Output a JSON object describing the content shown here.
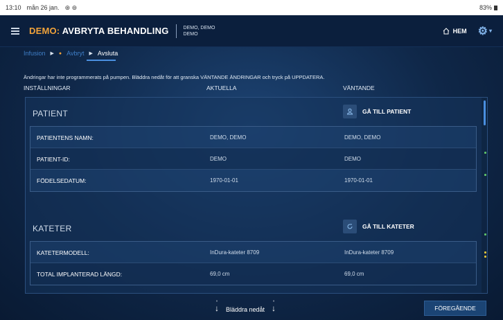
{
  "status_bar": {
    "time": "13:10",
    "date": "mån 26 jan.",
    "icons": "⊛ ⊚",
    "battery": "83%"
  },
  "app_bar": {
    "title_prefix": "DEMO:",
    "title_main": "AVBRYTA BEHANDLING",
    "patient_line1": "DEMO, DEMO",
    "patient_line2": "DEMO",
    "home_label": "HEM",
    "menu_icon": "hamburger-icon",
    "home_icon": "home-icon",
    "settings_icon": "gear-icon"
  },
  "breadcrumb": {
    "items": [
      {
        "label": "Infusion"
      },
      {
        "label": "Avbryt"
      },
      {
        "label": "Avsluta"
      }
    ],
    "arrow": "▶",
    "warning_dot": "●"
  },
  "notice": "Ändringar har inte programmerats på pumpen. Bläddra nedåt för att granska VÄNTANDE ÄNDRINGAR och tryck på UPPDATERA.",
  "columns": {
    "settings": "INSTÄLLNINGAR",
    "current": "AKTUELLA",
    "pending": "VÄNTANDE"
  },
  "sections": [
    {
      "title": "PATIENT",
      "goto_label": "GÅ TILL PATIENT",
      "icon": "person-icon",
      "rows": [
        {
          "label": "PATIENTENS NAMN:",
          "current": "DEMO, DEMO",
          "pending": "DEMO, DEMO"
        },
        {
          "label": "PATIENT-ID:",
          "current": "DEMO",
          "pending": "DEMO"
        },
        {
          "label": "FÖDELSEDATUM:",
          "current": "1970-01-01",
          "pending": "1970-01-01"
        }
      ]
    },
    {
      "title": "KATETER",
      "goto_label": "GÅ TILL KATETER",
      "icon": "catheter-icon",
      "rows": [
        {
          "label": "KATETERMODELL:",
          "current": "InDura-kateter 8709",
          "pending": "InDura-kateter 8709"
        },
        {
          "label": "TOTAL IMPLANTERAD LÄNGD:",
          "current": "69,0 cm",
          "pending": "69,0 cm"
        }
      ]
    }
  ],
  "footer": {
    "scroll_down_label": "Bläddra nedåt",
    "previous_label": "FÖREGÅENDE"
  },
  "colors": {
    "accent_orange": "#f0a23a",
    "accent_blue": "#4a8fe0",
    "marker_green": "#5fc36a",
    "marker_yellow": "#e0c23a"
  }
}
